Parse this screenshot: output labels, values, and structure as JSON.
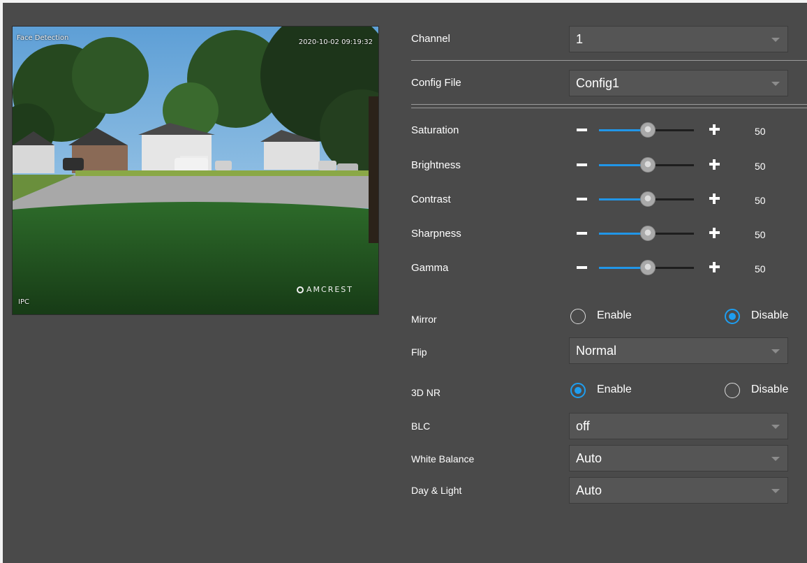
{
  "preview": {
    "osd_top_left": "Face Detection",
    "osd_timestamp": "2020-10-02 09:19:32",
    "osd_bottom_left": "IPC",
    "brand": "AMCREST"
  },
  "channel": {
    "label": "Channel",
    "value": "1"
  },
  "config_file": {
    "label": "Config File",
    "value": "Config1"
  },
  "sliders": [
    {
      "label": "Saturation",
      "value": 50,
      "value_text": "50"
    },
    {
      "label": "Brightness",
      "value": 50,
      "value_text": "50"
    },
    {
      "label": "Contrast",
      "value": 50,
      "value_text": "50"
    },
    {
      "label": "Sharpness",
      "value": 50,
      "value_text": "50"
    },
    {
      "label": "Gamma",
      "value": 50,
      "value_text": "50"
    }
  ],
  "mirror": {
    "label": "Mirror",
    "option_enable": "Enable",
    "option_disable": "Disable",
    "selected": "Disable"
  },
  "flip": {
    "label": "Flip",
    "value": "Normal"
  },
  "nr3d": {
    "label": "3D NR",
    "option_enable": "Enable",
    "option_disable": "Disable",
    "selected": "Enable"
  },
  "blc": {
    "label": "BLC",
    "value": "off"
  },
  "white_balance": {
    "label": "White Balance",
    "value": "Auto"
  },
  "day_light": {
    "label": "Day & Light",
    "value": "Auto"
  },
  "colors": {
    "accent": "#2196e8",
    "background": "#4a4a4a",
    "field": "#555555"
  },
  "icons": {
    "slider_decrease": "minus-icon",
    "slider_increase": "plus-icon",
    "dropdown": "chevron-down-icon"
  }
}
